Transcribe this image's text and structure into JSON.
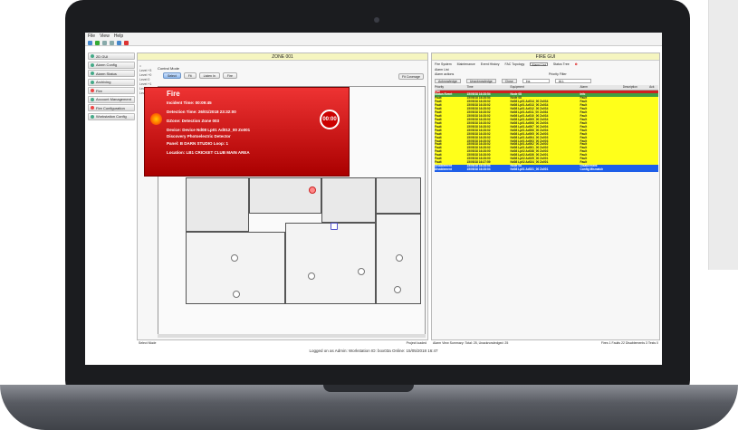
{
  "menu": [
    "File",
    "View",
    "Help"
  ],
  "nav": [
    {
      "label": "2D GUI"
    },
    {
      "label": "Alarm Config"
    },
    {
      "label": "Alarm Status"
    },
    {
      "label": "Archiving"
    },
    {
      "label": "Fire"
    },
    {
      "label": "Account Management"
    },
    {
      "label": "Fire Configuration"
    },
    {
      "label": "Workstation Config"
    }
  ],
  "zone": {
    "title": "ZONE 001",
    "levels": [
      "Level +3",
      "Level +0",
      "Level 0",
      "Level +1",
      "Level -1",
      "Level -2"
    ],
    "control_mode": "Control Mode",
    "buttons": [
      "Select",
      "Fit",
      "Listen In",
      "Fire"
    ],
    "fit_coverage": "Fit Coverage",
    "status_left": "Select Mode",
    "status_right": "Project loaded"
  },
  "alarm": {
    "title": "Fire",
    "incident": "Incident Time: 00:09:45",
    "detection": "Detection Time: 26/01/2018 23:32:00",
    "dzone": "DZone: Detection Zone 003",
    "device": "Device: Device Nd08 Lp01 Ad012_00 Zo001",
    "desc": "Discovery Photoelectric Detector",
    "panel": "Panel: B DARN STUDIO Loop: 1",
    "location": "Location: LB1 CRICKET CLUB MAIN AREA",
    "timer": "00:00"
  },
  "gui": {
    "title": "FIRE GUI",
    "tabs": [
      "Fire System",
      "Maintenance",
      "Event History",
      "FAC Topology",
      "Alarm List",
      "Status Tree"
    ],
    "alarm_list": "Alarm List",
    "alarm_actions": "Alarm actions",
    "priority_filter": "Priority Filter",
    "action_buttons": [
      "Acknowledge",
      "Unacknowledge",
      "Close"
    ],
    "filter_values": [
      "Ins",
      "ALL"
    ],
    "columns": [
      "Priority",
      "Time",
      "Equipment",
      "Alarm",
      "Description",
      "Ack"
    ],
    "rows": [
      {
        "p": "Fire",
        "t": "",
        "e": "",
        "a": "",
        "c": "red"
      },
      {
        "p": "Status Event",
        "t": "15/05/18 16:28:54",
        "e": "Node 08",
        "a": "Info",
        "c": "grn"
      },
      {
        "p": "Fault",
        "t": "15/05/18 16:28:54",
        "e": "Node 08",
        "a": "Fault",
        "c": "yel"
      },
      {
        "p": "Fault",
        "t": "15/05/18 16:28:02",
        "e": "Nd08 Lp01 Ad014_00 Zo034",
        "a": "Fault",
        "c": "yel"
      },
      {
        "p": "Fault",
        "t": "15/05/18 16:28:02",
        "e": "Nd08 Lp01 Ad013_00 Zo034",
        "a": "Fault",
        "c": "yel"
      },
      {
        "p": "Fault",
        "t": "15/05/18 16:28:02",
        "e": "Nd08 Lp01 Ad012_00 Zo034",
        "a": "Fault",
        "c": "yel"
      },
      {
        "p": "Fault",
        "t": "15/05/18 16:28:02",
        "e": "Nd08 Lp01 Ad011_00 Zo034",
        "a": "Fault",
        "c": "yel"
      },
      {
        "p": "Fault",
        "t": "15/05/18 16:28:02",
        "e": "Nd08 Lp01 Ad010_00 Zo034",
        "a": "Fault",
        "c": "yel"
      },
      {
        "p": "Fault",
        "t": "15/05/18 16:28:02",
        "e": "Nd08 Lp01 Ad009_00 Zo034",
        "a": "Fault",
        "c": "yel"
      },
      {
        "p": "Fault",
        "t": "15/05/18 16:28:02",
        "e": "Nd08 Lp01 Ad008_00 Zo004",
        "a": "Fault",
        "c": "yel"
      },
      {
        "p": "Fault",
        "t": "15/05/18 16:28:02",
        "e": "Nd08 Lp01 Ad007_00 Zo004",
        "a": "Fault",
        "c": "yel"
      },
      {
        "p": "Fault",
        "t": "15/05/18 16:28:02",
        "e": "Nd08 Lp01 Ad006_00 Zo004",
        "a": "Fault",
        "c": "yel"
      },
      {
        "p": "Fault",
        "t": "15/05/18 16:28:02",
        "e": "Nd08 Lp01 Ad005_00 Zo003",
        "a": "Fault",
        "c": "yel"
      },
      {
        "p": "Fault",
        "t": "15/05/18 16:28:02",
        "e": "Nd08 Lp01 Ad004_00 Zo003",
        "a": "Fault",
        "c": "yel"
      },
      {
        "p": "Fault",
        "t": "15/05/18 16:28:02",
        "e": "Nd08 Lp01 Ad003_00 Zo003",
        "a": "Fault",
        "c": "yel"
      },
      {
        "p": "Fault",
        "t": "15/05/18 16:28:02",
        "e": "Nd08 Lp01 Ad002_00 Zo002",
        "a": "Fault",
        "c": "yel"
      },
      {
        "p": "Fault",
        "t": "15/05/18 16:28:02",
        "e": "Nd08 Lp01 Ad001_00 Zo002",
        "a": "Fault",
        "c": "yel"
      },
      {
        "p": "Fault",
        "t": "15/05/18 16:28:00",
        "e": "Nd08 Lp02 Ad038_00 Zo002",
        "a": "Fault",
        "c": "yel"
      },
      {
        "p": "Fault",
        "t": "15/05/18 16:28:00",
        "e": "Nd08 Lp02 Ad026_00 Zo001",
        "a": "Fault",
        "c": "yel"
      },
      {
        "p": "Fault",
        "t": "15/05/18 16:28:00",
        "e": "Nd08 Lp02 Ad025_00 Zo001",
        "a": "Fault",
        "c": "yel"
      },
      {
        "p": "Fault",
        "t": "15/05/18 16:27:59",
        "e": "Nd08 Lp02 Ad024_00 Zo001",
        "a": "Fault",
        "c": "yel"
      },
      {
        "p": "Disablement",
        "t": "15/05/18 16:28:04",
        "e": "Node 08",
        "a": "Disablement",
        "c": "blu"
      },
      {
        "p": "Disablement",
        "t": "15/05/18 16:28:04",
        "e": "Nd08 Lp01 Ad021_00 Zo001",
        "a": "Config Mismatch",
        "c": "blu"
      }
    ],
    "summary": "Alarm View Summary: Total: 25, Unacknowledged: 25",
    "counts": "Fires 1 Faults 22 Disablements 3 Tests 0"
  },
  "footer": "Logged on as Admin: Workstation ID: box03a Online: 15/05/2018 16:47"
}
